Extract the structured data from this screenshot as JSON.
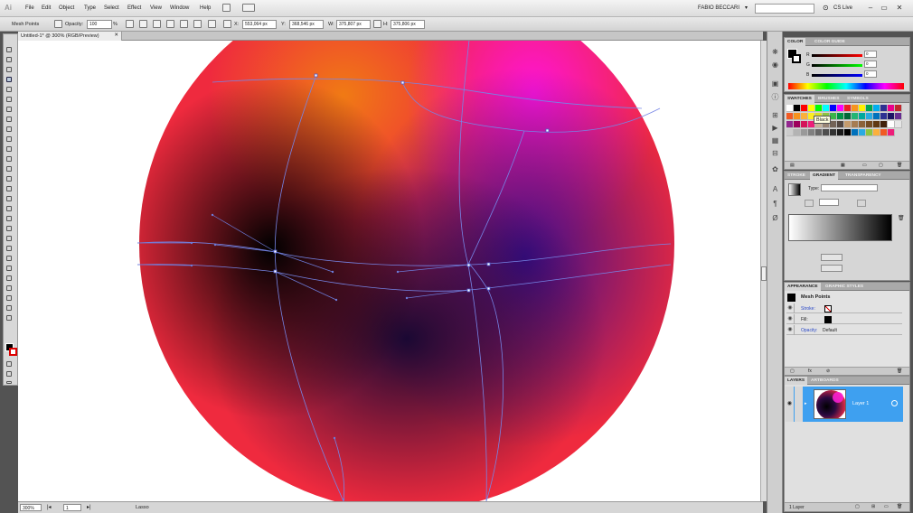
{
  "app": {
    "logo": "Ai",
    "menu": [
      "File",
      "Edit",
      "Object",
      "Type",
      "Select",
      "Effect",
      "View",
      "Window",
      "Help"
    ],
    "user": "FABIO BECCARI",
    "search_placeholder": "",
    "cs_live": "CS Live"
  },
  "control_bar": {
    "tool_name": "Mesh Points",
    "opacity_label": "Opacity:",
    "opacity_value": "100",
    "opacity_unit": "%",
    "x_label": "X:",
    "x_value": "553,064 px",
    "y_label": "Y:",
    "y_value": "368,546 px",
    "w_label": "W:",
    "w_value": "375,807 px",
    "h_label": "H:",
    "h_value": "375,806 px"
  },
  "document": {
    "tab_title": "Untitled-1* @ 300% (RGB/Preview)"
  },
  "status": {
    "zoom": "300%",
    "page": "1",
    "tool": "Lasso"
  },
  "color_panel": {
    "tabs": [
      "COLOR",
      "COLOR GUIDE"
    ],
    "r_label": "R",
    "g_label": "G",
    "b_label": "B",
    "r_value": "0",
    "g_value": "0",
    "b_value": "0"
  },
  "swatches_panel": {
    "tabs": [
      "SWATCHES",
      "BRUSHES",
      "SYMBOLS"
    ],
    "tooltip": "Black",
    "colors": [
      "#ffffff",
      "#000000",
      "#ff0000",
      "#ffff00",
      "#00ff00",
      "#00ffff",
      "#0000ff",
      "#ff00ff",
      "#ee1d24",
      "#f7941d",
      "#fff200",
      "#00a651",
      "#00aeef",
      "#2e3192",
      "#ec008c",
      "#c1272d",
      "#f15a24",
      "#f7931e",
      "#fbb03b",
      "#fcee21",
      "#d9e021",
      "#8cc63f",
      "#39b54a",
      "#009245",
      "#006837",
      "#22b573",
      "#00a99d",
      "#29abe2",
      "#0071bc",
      "#2e3192",
      "#1b1464",
      "#662d91",
      "#93278f",
      "#9e005d",
      "#d4145a",
      "#ed1e79",
      "#c7b299",
      "#998675",
      "#736357",
      "#534741",
      "#c69c6d",
      "#a67c52",
      "#8c6239",
      "#754c24",
      "#603813",
      "#42210b",
      "#ffffff",
      "#e6e6e6",
      "#cccccc",
      "#b3b3b3",
      "#999999",
      "#808080",
      "#666666",
      "#4d4d4d",
      "#333333",
      "#1a1a1a",
      "#000000",
      "#0071bc",
      "#29abe2",
      "#8cc63f",
      "#fbb03b",
      "#f15a24",
      "#ed1e79"
    ]
  },
  "gradient_panel": {
    "tabs": [
      "STROKE",
      "GRADIENT",
      "TRANSPARENCY"
    ],
    "type_label": "Type:",
    "type_value": ""
  },
  "appearance_panel": {
    "tabs": [
      "APPEARANCE",
      "GRAPHIC STYLES"
    ],
    "title": "Mesh Points",
    "rows": [
      {
        "label": "Stroke:",
        "value": ""
      },
      {
        "label": "Fill:",
        "value": ""
      },
      {
        "label": "Opacity:",
        "value": "Default"
      }
    ]
  },
  "layers_panel": {
    "tabs": [
      "LAYERS",
      "ARTBOARDS"
    ],
    "layer_name": "Layer 1",
    "footer": "1 Layer"
  },
  "colors": {
    "accent": "#3ea0f0",
    "mesh_line": "#6f7fe0"
  }
}
